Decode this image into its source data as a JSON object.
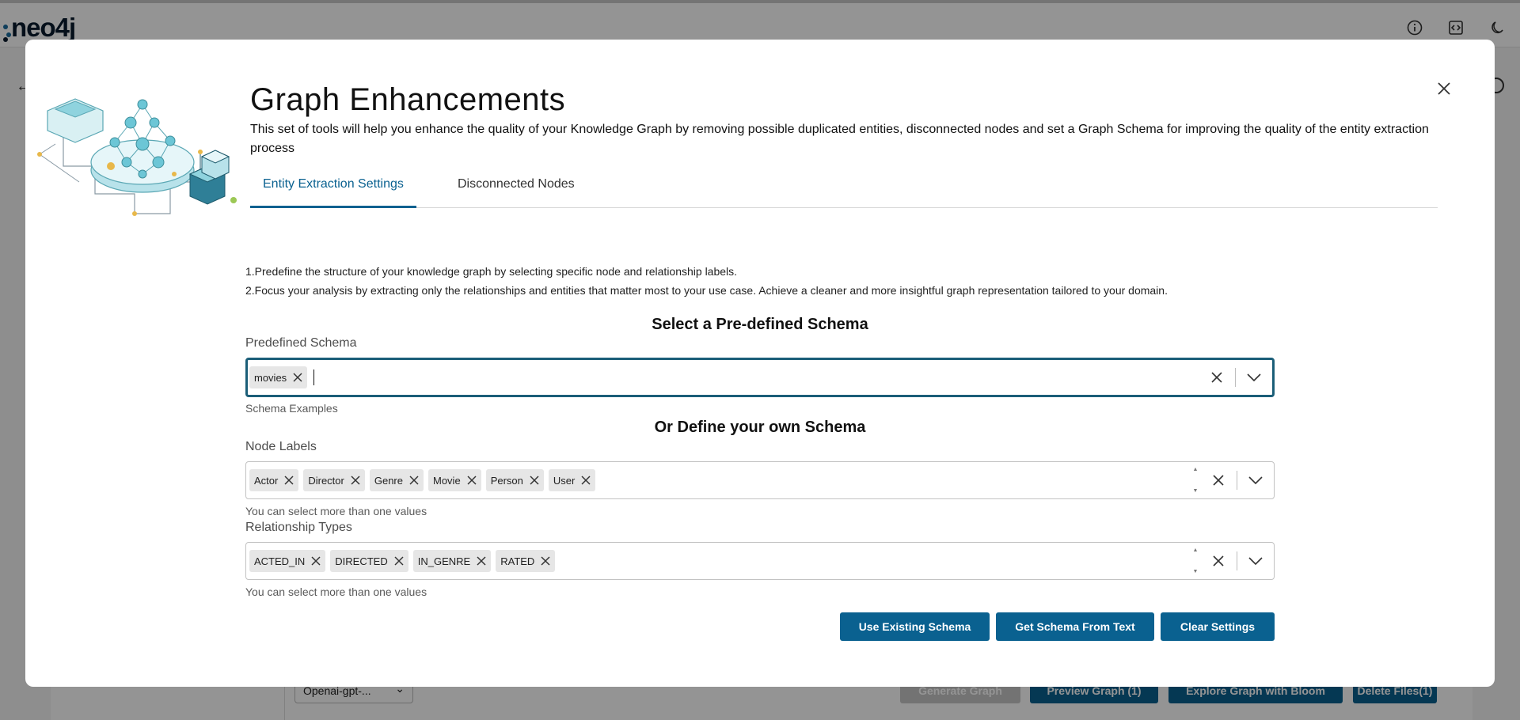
{
  "app": {
    "logo_text": "neo4j",
    "bg_model_select": "Openai-gpt-...",
    "bg_buttons": {
      "generate": "Generate Graph",
      "preview": "Preview Graph (1)",
      "bloom": "Explore Graph with Bloom",
      "delete": "Delete Files(1)"
    },
    "icons": [
      "info-icon",
      "code-icon",
      "moon-icon",
      "back-arrow-icon"
    ]
  },
  "modal": {
    "title": "Graph Enhancements",
    "subtitle": "This set of tools will help you enhance the quality of your Knowledge Graph by removing possible duplicated entities, disconnected nodes and set a Graph Schema for improving the quality of the entity extraction process",
    "tabs": [
      {
        "label": "Entity Extraction Settings",
        "active": true
      },
      {
        "label": "Disconnected Nodes",
        "active": false
      }
    ],
    "info_lines": [
      "1.Predefine the structure of your knowledge graph by selecting specific node and relationship labels.",
      "2.Focus your analysis by extracting only the relationships and entities that matter most to your use case. Achieve a cleaner and more insightful graph representation tailored to your domain."
    ],
    "predefined_heading": "Select a Pre-defined Schema",
    "predefined_label": "Predefined Schema",
    "predefined_chips": [
      "movies"
    ],
    "predefined_helper": "Schema Examples",
    "own_heading": "Or Define your own Schema",
    "node_labels_label": "Node Labels",
    "node_labels": [
      "Actor",
      "Director",
      "Genre",
      "Movie",
      "Person",
      "User"
    ],
    "node_labels_helper": "You can select more than one values",
    "rel_types_label": "Relationship Types",
    "rel_types": [
      "ACTED_IN",
      "DIRECTED",
      "IN_GENRE",
      "RATED"
    ],
    "rel_types_helper": "You can select more than one values",
    "buttons": {
      "use_existing": "Use Existing Schema",
      "from_text": "Get Schema From Text",
      "clear": "Clear Settings"
    }
  },
  "colors": {
    "accent": "#0a6190",
    "focus_border": "#1b5e78",
    "chip_bg": "#e6e6e6"
  }
}
